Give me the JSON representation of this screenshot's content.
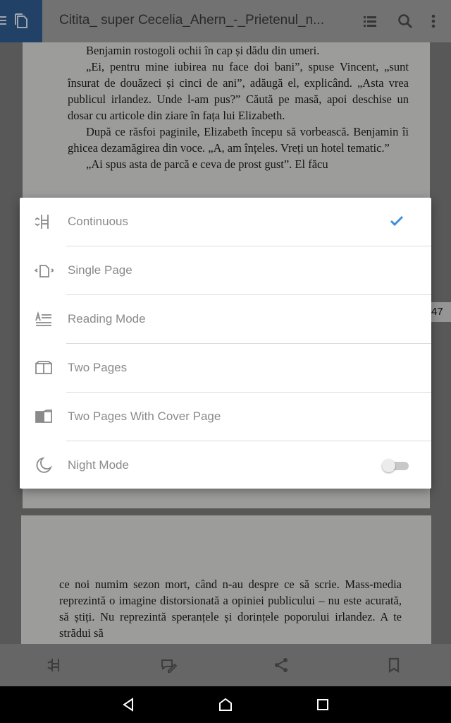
{
  "app_bar": {
    "title": "Citita_ super Cecelia_Ahern_-_Prietenul_n...",
    "icons": [
      "menu-icon",
      "pages-icon",
      "list-icon",
      "search-icon",
      "more-vert-icon"
    ],
    "accent_color": "#2f5a8f"
  },
  "page_top": {
    "paragraphs": [
      "Benjamin rostogoli ochii în cap și dădu din umeri.",
      "„Ei, pentru mine iubirea nu face doi bani”, spuse Vincent, „sunt însurat de douăzeci și cinci de ani”, adăugă el, explicând. „Asta vrea publicul irlandez. Unde l-am pus?” Căută pe masă, apoi deschise un dosar cu articole din ziare în fața lui Elizabeth.",
      "După ce răsfoi paginile, Elizabeth începu să vorbească. Benjamin îi ghicea dezamăgirea din voce. „A, am înțeles. Vreți un hotel tematic.”",
      "„Ai spus asta de parcă e ceva de prost gust”. El făcu"
    ],
    "page_number": "47"
  },
  "page_bottom": {
    "paragraphs": [
      "ce noi numim sezon mort, când n-au despre ce să scrie. Mass-media reprezintă o imagine distorsionată a opiniei publicului – nu este acurată, să știți. Nu reprezintă speranțele și dorințele poporului irlandez. A te strădui să"
    ]
  },
  "view_menu": {
    "items": [
      {
        "label": "Continuous",
        "icon": "continuous-scroll-icon",
        "selected": true
      },
      {
        "label": "Single Page",
        "icon": "single-page-icon",
        "selected": false
      },
      {
        "label": "Reading Mode",
        "icon": "reading-mode-icon",
        "selected": false
      },
      {
        "label": "Two Pages",
        "icon": "two-pages-icon",
        "selected": false
      },
      {
        "label": "Two Pages With Cover Page",
        "icon": "two-pages-cover-icon",
        "selected": false
      },
      {
        "label": "Night Mode",
        "icon": "moon-icon",
        "toggle": false
      }
    ],
    "check_color": "#3f8fd8"
  },
  "bottom_bar": {
    "icons": [
      "continuous-scroll-icon",
      "comment-edit-icon",
      "share-icon",
      "bookmark-icon"
    ]
  },
  "nav_bar": {
    "icons": [
      "back-icon",
      "home-icon",
      "recents-icon"
    ]
  }
}
